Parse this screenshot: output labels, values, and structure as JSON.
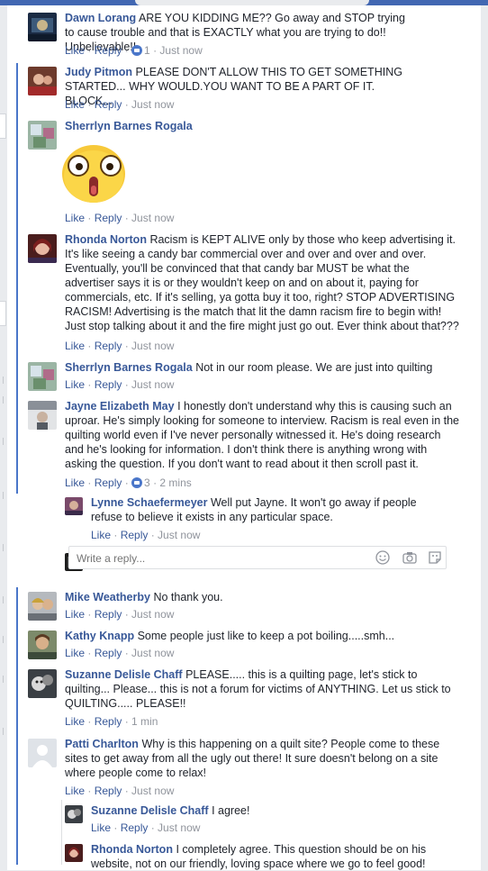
{
  "colors": {
    "link": "#385898",
    "meta": "#90949c",
    "thread_bar": "#4a76c9",
    "fb_blue": "#4267b2"
  },
  "actions": {
    "like": "Like",
    "reply": "Reply",
    "sep": " · "
  },
  "comments": [
    {
      "name": "Dawn Lorang",
      "text": "ARE YOU KIDDING ME?? Go away and STOP trying to cause trouble and that is EXACTLY what you are trying to do!! Unbelievable!!",
      "reactions": "1",
      "time": "Just now"
    },
    {
      "name": "Judy Pitmon",
      "text": "PLEASE DON'T ALLOW THIS TO GET SOMETHING STARTED... WHY WOULD.YOU WANT TO BE A PART OF IT. BLOCK...",
      "time": "Just now"
    },
    {
      "name": "Sherrlyn Barnes Rogala",
      "text": "",
      "sticker": "shocked-face-sticker",
      "time": "Just now"
    },
    {
      "name": "Rhonda Norton",
      "text": "Racism is KEPT ALIVE only by those who keep advertising it. It's like seeing a candy bar commercial over and over and over and over. Eventually, you'll be convinced that that candy bar MUST be what the advertiser says it is or they wouldn't keep on and on about it, paying for commercials, etc. If it's selling, ya gotta buy it too, right? STOP ADVERTISING RACISM! Advertising is the match that lit the damn racism fire to begin with! Just stop talking about it and the fire might just go out. Ever think about that???",
      "time": "Just now"
    },
    {
      "name": "Sherrlyn Barnes Rogala",
      "text": "Not in our room please. We are just into quilting",
      "time": "Just now"
    },
    {
      "name": "Jayne Elizabeth May",
      "text": "I honestly don't understand why this is causing such an uproar. He's simply looking for someone to interview. Racism is real even in the quilting world even if I've never personally witnessed it. He's doing research and he's looking for information. I don't think there is anything wrong with asking the question. If you don't want to read about it then scroll past it.",
      "reactions": "3",
      "time": "2 mins"
    },
    {
      "name": "Lynne Schaefermeyer",
      "text": "Well put Jayne. It won't go away if people refuse to believe it exists in any particular space.",
      "time": "Just now"
    },
    {
      "name": "Mike Weatherby",
      "text": "No thank you.",
      "time": "Just now"
    },
    {
      "name": "Kathy Knapp",
      "text": "Some people just like to keep a pot boiling.....smh...",
      "time": "Just now"
    },
    {
      "name": "Suzanne Delisle Chaff",
      "text": "PLEASE..... this is a quilting page, let's stick to quilting... Please... this is not a forum for victims of ANYTHING. Let us stick to QUILTING..... PLEASE!!",
      "time": "1 min"
    },
    {
      "name": "Patti Charlton",
      "text": "Why is this happening on a quilt site? People come to these sites to get away from all the ugly out there! It sure doesn't belong on a site where people come to relax!",
      "time": "Just now"
    },
    {
      "name": "Suzanne Delisle Chaff",
      "text": "I agree!",
      "time": "Just now"
    },
    {
      "name": "Rhonda Norton",
      "text": "I completely agree. This question should be on his website, not on our friendly, loving space where we go to feel good!",
      "time": ""
    }
  ],
  "reply_box": {
    "placeholder": "Write a reply...",
    "icons": [
      "emoji-icon",
      "camera-icon",
      "sticker-icon"
    ]
  }
}
